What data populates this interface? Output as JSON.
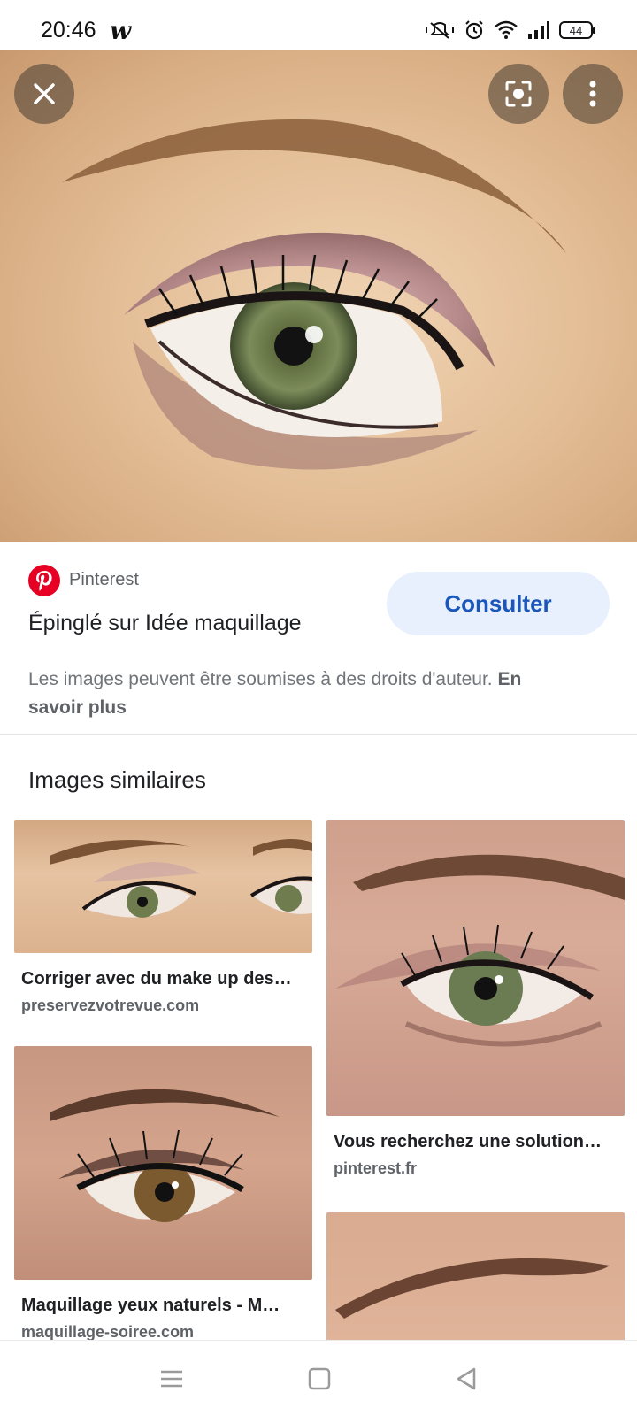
{
  "status_bar": {
    "time": "20:46",
    "app_glyph": "w",
    "battery": "44",
    "icons": [
      "mute-vibrate-icon",
      "alarm-icon",
      "wifi-icon",
      "signal-icon",
      "battery-icon"
    ]
  },
  "hero": {
    "description_icon": "eye-makeup-image"
  },
  "source": {
    "site": "Pinterest",
    "title": "Épinglé sur Idée maquillage",
    "visit_label": "Consulter",
    "copyright_text": "Les images peuvent être soumises à des droits d'auteur.",
    "learn_more": "En savoir plus"
  },
  "similar": {
    "heading": "Images similaires",
    "items": [
      {
        "title": "Corriger avec du make up des…",
        "source": "preservezvotrevue.com"
      },
      {
        "title": "Vous recherchez une solution…",
        "source": "pinterest.fr"
      },
      {
        "title": "Maquillage yeux naturels - M…",
        "source": "maquillage-soiree.com"
      },
      {
        "title": "",
        "source": ""
      }
    ]
  },
  "colors": {
    "accent": "#1a57b8",
    "button_bg": "#e8f0fe",
    "pinterest_red": "#e60023"
  }
}
